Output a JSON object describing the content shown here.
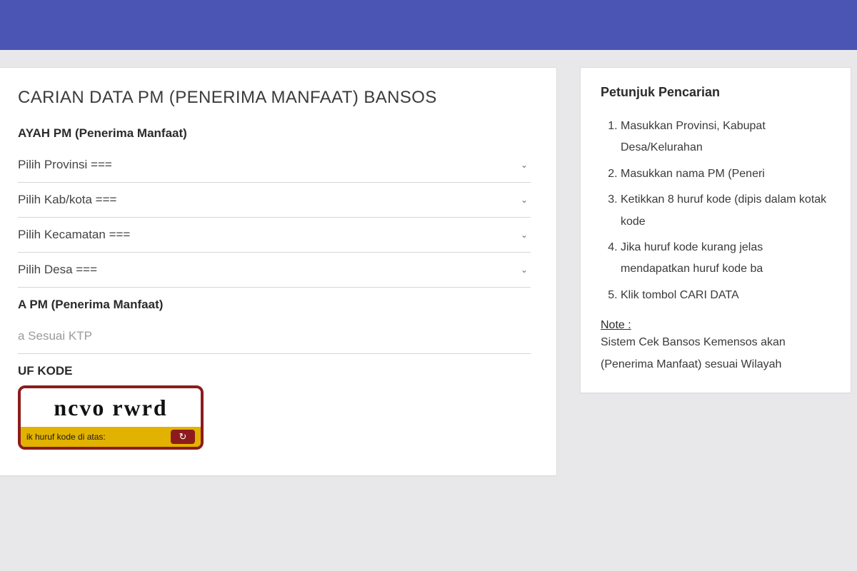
{
  "header": {},
  "main": {
    "title": "CARIAN DATA PM (PENERIMA MANFAAT) BANSOS",
    "wilayah_label": "AYAH PM (Penerima Manfaat)",
    "selects": {
      "provinsi": "Pilih Provinsi ===",
      "kabkota": "Pilih Kab/kota ===",
      "kecamatan": "Pilih Kecamatan ===",
      "desa": "Pilih Desa ==="
    },
    "nama_label": "A PM (Penerima Manfaat)",
    "nama_placeholder": "a Sesuai KTP",
    "kode_label": "UF KODE",
    "captcha_text": "ncvo  rwrd",
    "captcha_hint": "ik huruf kode di atas:"
  },
  "sidebar": {
    "title": "Petunjuk Pencarian",
    "steps": [
      "Masukkan Provinsi, Kabupat Desa/Kelurahan",
      "Masukkan nama PM (Peneri",
      "Ketikkan 8 huruf kode (dipis dalam kotak kode",
      "Jika huruf kode kurang jelas mendapatkan huruf kode ba",
      "Klik tombol CARI DATA"
    ],
    "note_label": "Note :",
    "note_text": "Sistem Cek Bansos Kemensos akan (Penerima Manfaat) sesuai Wilayah"
  }
}
